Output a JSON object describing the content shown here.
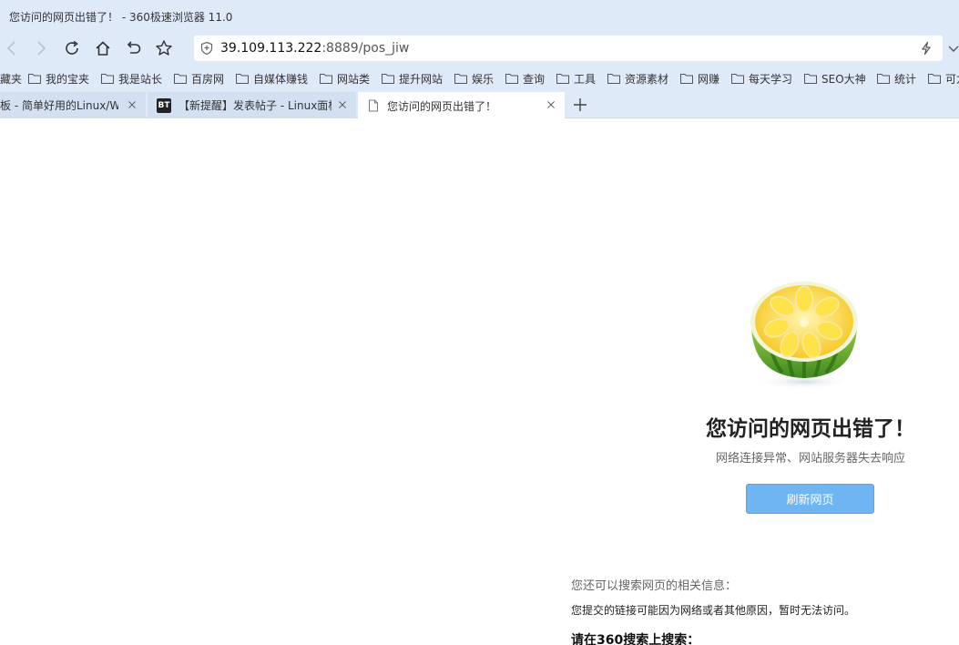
{
  "window": {
    "title": "您访问的网页出错了！ - 360极速浏览器 11.0"
  },
  "navbar": {
    "back_icon": "back-arrow-icon",
    "forward_icon": "forward-arrow-icon",
    "reload_icon": "reload-icon",
    "home_icon": "home-icon",
    "undo_icon": "undo-close-icon",
    "star_icon": "star-icon",
    "address": {
      "host": "39.109.113.222",
      "rest": ":8889/pos_jiw"
    }
  },
  "bookmarks": [
    {
      "label": "藏夹",
      "folder": false
    },
    {
      "label": "我的宝夹",
      "folder": true
    },
    {
      "label": "我是站长",
      "folder": true
    },
    {
      "label": "百房网",
      "folder": true
    },
    {
      "label": "自媒体赚钱",
      "folder": true
    },
    {
      "label": "网站类",
      "folder": true
    },
    {
      "label": "提升网站",
      "folder": true
    },
    {
      "label": "娱乐",
      "folder": true
    },
    {
      "label": "查询",
      "folder": true
    },
    {
      "label": "工具",
      "folder": true
    },
    {
      "label": "资源素材",
      "folder": true
    },
    {
      "label": "网赚",
      "folder": true
    },
    {
      "label": "每天学习",
      "folder": true
    },
    {
      "label": "SEO大神",
      "folder": true
    },
    {
      "label": "统计",
      "folder": true
    },
    {
      "label": "可龙",
      "folder": true
    }
  ],
  "tabs": [
    {
      "title": "板 - 简单好用的Linux/W",
      "active": false
    },
    {
      "title": "【新提醒】发表帖子 - Linux面板",
      "active": false,
      "favicon_text": "BT"
    },
    {
      "title": "您访问的网页出错了！",
      "active": true
    }
  ],
  "page": {
    "error_title": "您访问的网页出错了！",
    "error_subtitle": "网络连接异常、网站服务器失去响应",
    "refresh_label": "刷新网页",
    "hint_search": "您还可以搜索网页的相关信息：",
    "hint_reason": "您提交的链接可能因为网络或者其他原因，暂时无法访问。",
    "hint_360": "请在360搜索上搜索："
  }
}
